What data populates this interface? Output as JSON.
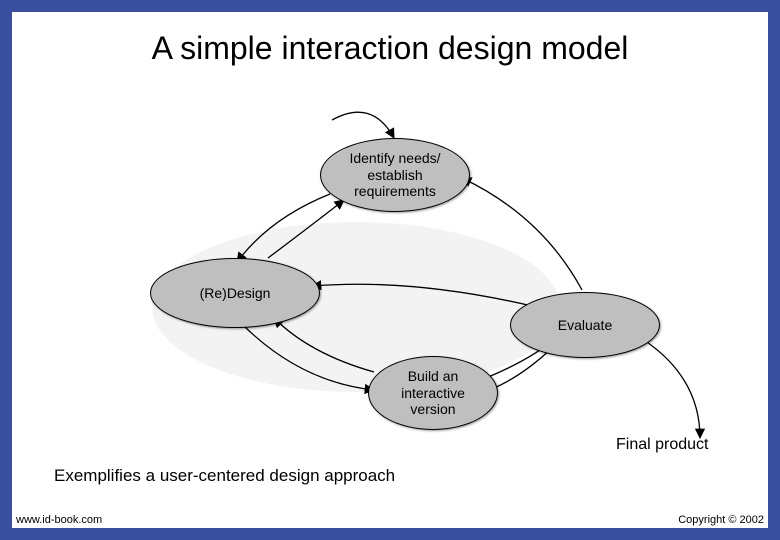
{
  "title": "A simple interaction design model",
  "nodes": {
    "identify": {
      "line1": "Identify needs/",
      "line2": "establish",
      "line3": "requirements"
    },
    "redesign": {
      "label": "(Re)Design"
    },
    "build": {
      "line1": "Build an",
      "line2": "interactive",
      "line3": "version"
    },
    "evaluate": {
      "label": "Evaluate"
    }
  },
  "final_product": "Final product",
  "caption": "Exemplifies a user-centered design approach",
  "footer": {
    "left": "www.id-book.com",
    "right": "Copyright © 2002"
  }
}
